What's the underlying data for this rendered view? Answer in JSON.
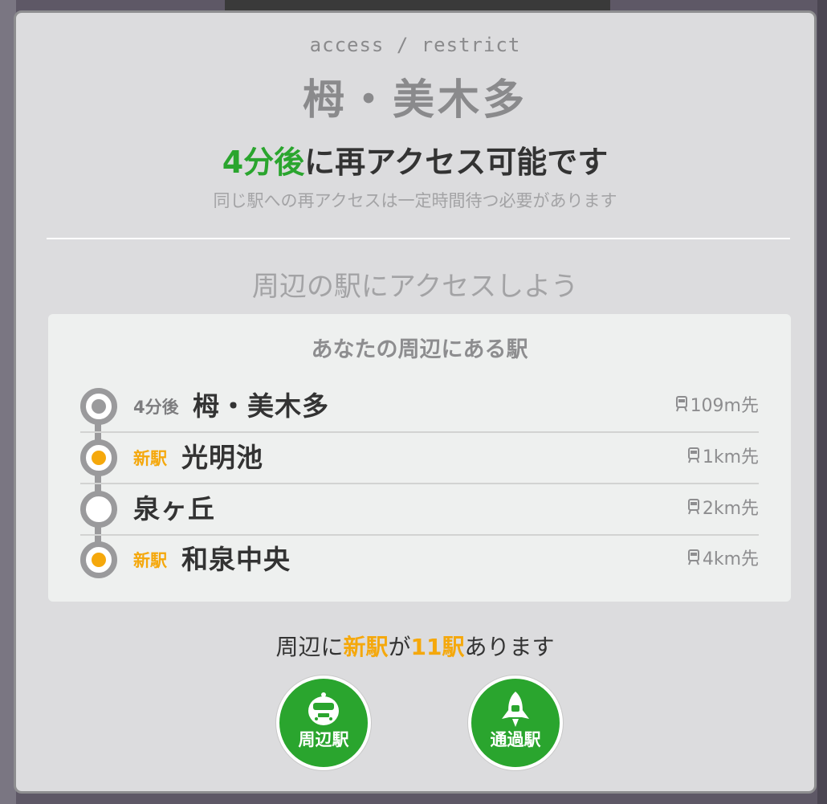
{
  "header": {
    "subtitle": "access / restrict",
    "station": "栂・美木多",
    "reaccess_time": "4分後",
    "reaccess_rest": "に再アクセス可能です",
    "note": "同じ駅への再アクセスは一定時間待つ必要があります"
  },
  "section_title": "周辺の駅にアクセスしよう",
  "nearby": {
    "title": "あなたの周辺にある駅",
    "stations": [
      {
        "label": "4分後",
        "status": "wait",
        "name": "栂・美木多",
        "distance": "109m先"
      },
      {
        "label": "新駅",
        "status": "new",
        "name": "光明池",
        "distance": "1km先"
      },
      {
        "label": "",
        "status": "plain",
        "name": "泉ヶ丘",
        "distance": "2km先"
      },
      {
        "label": "新駅",
        "status": "new",
        "name": "和泉中央",
        "distance": "4km先"
      }
    ]
  },
  "summary": {
    "prefix": "周辺に",
    "new_label": "新駅",
    "middle": "が",
    "count": "11駅",
    "suffix": "あります"
  },
  "buttons": {
    "nearby_label": "周辺駅",
    "pass_label": "通過駅"
  },
  "colors": {
    "accent_green": "#2aa52e",
    "accent_orange": "#f5a80c",
    "panel": "#dcdcde"
  },
  "icons": {
    "distance": "train-icon",
    "nearby_button": "train-front-icon",
    "pass_button": "rocket-icon"
  }
}
